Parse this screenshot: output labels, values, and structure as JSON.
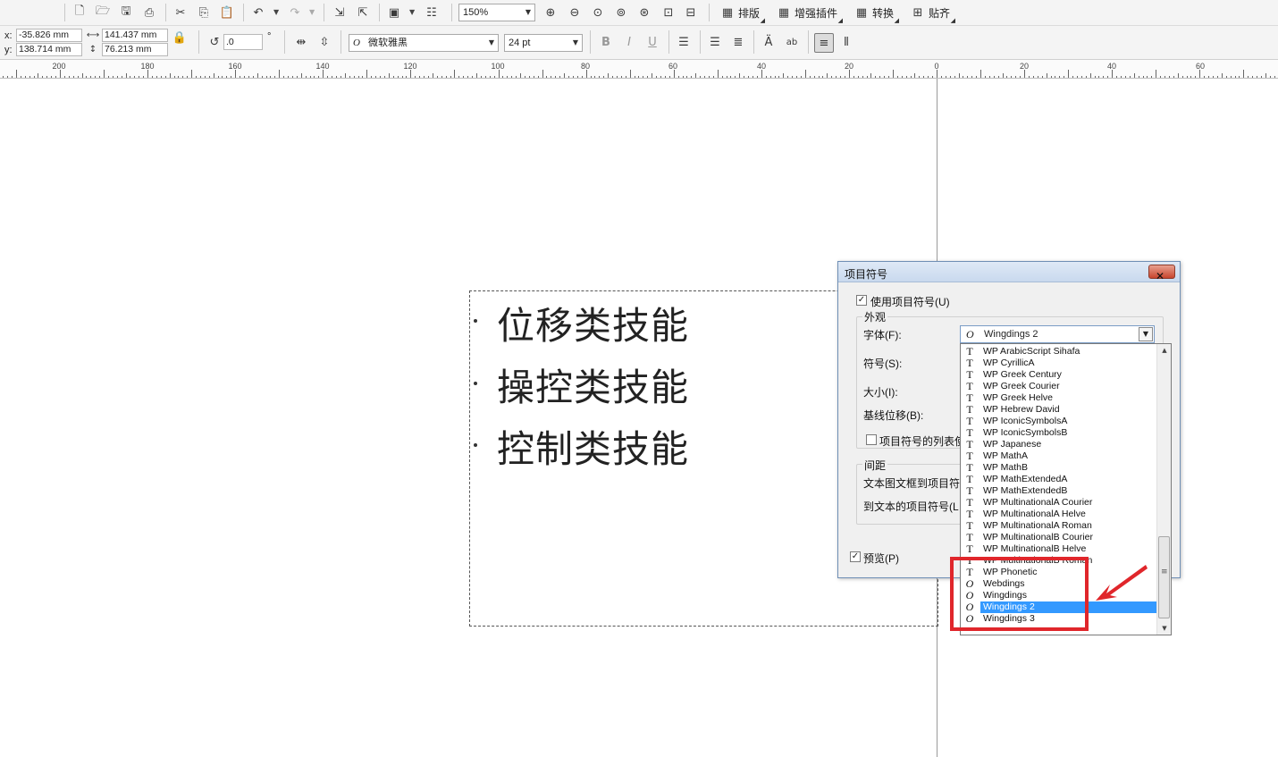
{
  "toolbar1": {
    "zoom_value": "150%",
    "menu_buttons": [
      {
        "label": "排版",
        "icon": "layout-icon"
      },
      {
        "label": "增强插件",
        "icon": "plugin-icon"
      },
      {
        "label": "转换",
        "icon": "convert-icon"
      },
      {
        "label": "贴齐",
        "icon": "snap-icon"
      }
    ]
  },
  "toolbar2": {
    "x_label": "x:",
    "x_value": "-35.826 mm",
    "y_label": "y:",
    "y_value": "138.714 mm",
    "width_value": "141.437 mm",
    "height_value": "76.213 mm",
    "rotation_value": ".0",
    "degree_symbol": "°",
    "font_name": "微软雅黑",
    "font_size": "24 pt",
    "font_glyph": "O"
  },
  "ruler": {
    "labels": [
      "200",
      "180",
      "160",
      "140",
      "120",
      "100",
      "80",
      "60",
      "40",
      "20",
      "0",
      "20",
      "40",
      "60"
    ]
  },
  "canvas": {
    "text_lines": [
      "位移类技能",
      "操控类技能",
      "控制类技能"
    ]
  },
  "dialog": {
    "title": "项目符号",
    "close_glyph": "✕",
    "use_bullets_label": "使用项目符号(U)",
    "use_bullets_checked": true,
    "appearance_label": "外观",
    "font_label": "字体(F):",
    "font_value": "Wingdings 2",
    "symbol_label": "符号(S):",
    "size_label": "大小(I):",
    "baseline_label": "基线位移(B):",
    "list_bullet_label": "项目符号的列表使",
    "list_bullet_checked": false,
    "spacing_label": "间距",
    "frame_to_bullet_label": "文本图文框到项目符",
    "bullet_to_text_label": "到文本的项目符号(L",
    "preview_label": "预览(P)",
    "preview_checked": true
  },
  "font_list": {
    "items": [
      {
        "name": "WP ArabicScript Sihafa",
        "type": "T"
      },
      {
        "name": "WP CyrillicA",
        "type": "T"
      },
      {
        "name": "WP Greek Century",
        "type": "T"
      },
      {
        "name": "WP Greek Courier",
        "type": "T"
      },
      {
        "name": "WP Greek Helve",
        "type": "T"
      },
      {
        "name": "WP Hebrew David",
        "type": "T"
      },
      {
        "name": "WP IconicSymbolsA",
        "type": "T"
      },
      {
        "name": "WP IconicSymbolsB",
        "type": "T"
      },
      {
        "name": "WP Japanese",
        "type": "T"
      },
      {
        "name": "WP MathA",
        "type": "T"
      },
      {
        "name": "WP MathB",
        "type": "T"
      },
      {
        "name": "WP MathExtendedA",
        "type": "T"
      },
      {
        "name": "WP MathExtendedB",
        "type": "T"
      },
      {
        "name": "WP MultinationalA Courier",
        "type": "T"
      },
      {
        "name": "WP MultinationalA Helve",
        "type": "T"
      },
      {
        "name": "WP MultinationalA Roman",
        "type": "T"
      },
      {
        "name": "WP MultinationalB Courier",
        "type": "T"
      },
      {
        "name": "WP MultinationalB Helve",
        "type": "T"
      },
      {
        "name": "WP MultinationalB Roman",
        "type": "T"
      },
      {
        "name": "WP Phonetic",
        "type": "T"
      },
      {
        "name": "Webdings",
        "type": "O"
      },
      {
        "name": "Wingdings",
        "type": "O"
      },
      {
        "name": "Wingdings 2",
        "type": "O",
        "selected": true
      },
      {
        "name": "Wingdings 3",
        "type": "O"
      }
    ],
    "selected_color": "#3399ff"
  },
  "annotation": {
    "highlight_color": "#e0262b"
  }
}
